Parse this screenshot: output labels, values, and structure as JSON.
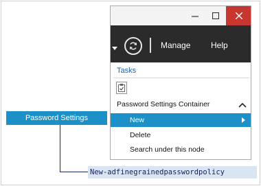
{
  "window": {
    "controls": {
      "minimize_icon": "minimize-icon",
      "maximize_icon": "maximize-icon",
      "close_icon": "close-icon",
      "close_color": "#c7372f"
    },
    "toolbar": {
      "manage_label": "Manage",
      "help_label": "Help",
      "background": "#2b2b2b"
    },
    "tasks": {
      "heading": "Tasks",
      "section_title": "Password Settings Container",
      "items": [
        {
          "label": "New",
          "selected": true
        },
        {
          "label": "Delete"
        },
        {
          "label": "Search under this node"
        }
      ]
    }
  },
  "callout": {
    "label": "Password Settings",
    "accent": "#1e90c8"
  },
  "command": {
    "text": "New-adfinegrainedpasswordpolicy",
    "background": "#d9e6f2"
  }
}
